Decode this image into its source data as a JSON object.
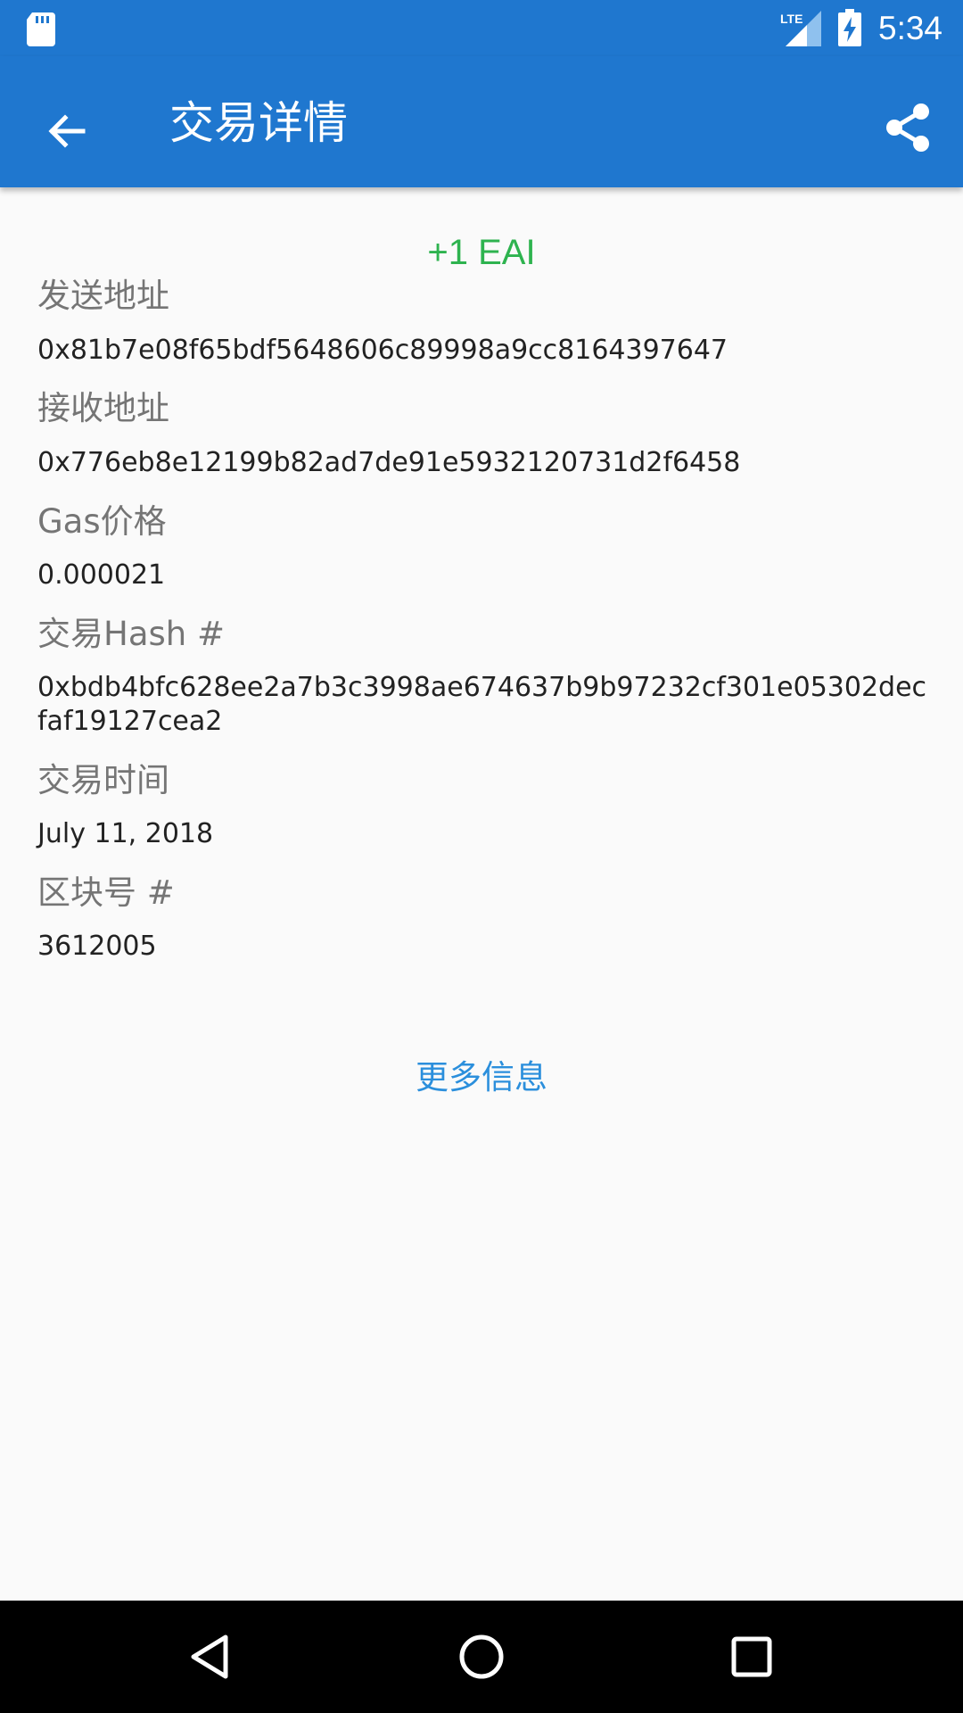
{
  "status_bar": {
    "time": "5:34",
    "network_label": "LTE",
    "icons": [
      "sd-card-icon",
      "lte-signal-icon",
      "battery-charging-icon"
    ]
  },
  "app_bar": {
    "title": "交易详情",
    "back_icon": "arrow-back-icon",
    "share_icon": "share-icon",
    "color": "#1f77cf"
  },
  "transaction": {
    "amount": "+1 EAI",
    "amount_color": "#2eb34f",
    "fields": [
      {
        "label": "发送地址",
        "value": "0x81b7e08f65bdf5648606c89998a9cc8164397647"
      },
      {
        "label": "接收地址",
        "value": "0x776eb8e12199b82ad7de91e5932120731d2f6458"
      },
      {
        "label": "Gas价格",
        "value": "0.000021"
      },
      {
        "label": "交易Hash #",
        "value": "0xbdb4bfc628ee2a7b3c3998ae674637b9b97232cf301e05302decfaf19127cea2"
      },
      {
        "label": "交易时间",
        "value": "July 11, 2018"
      },
      {
        "label": "区块号 #",
        "value": "3612005"
      }
    ]
  },
  "more_info_label": "更多信息",
  "link_color": "#2b8fdc",
  "nav_bar": {
    "icons": [
      "nav-back-icon",
      "nav-home-icon",
      "nav-recents-icon"
    ]
  }
}
